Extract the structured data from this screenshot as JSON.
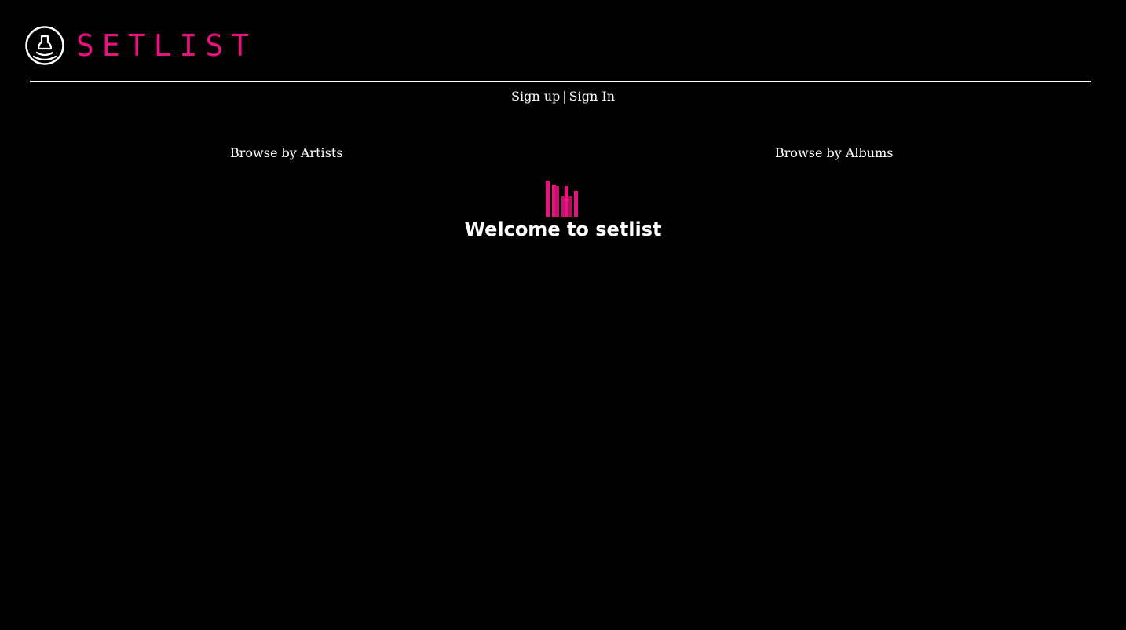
{
  "header": {
    "brand": "SETLIST",
    "logo_icon": "bell-waves-icon"
  },
  "auth": {
    "sign_up_label": "Sign up",
    "separator": "|",
    "sign_in_label": "Sign In"
  },
  "nav": {
    "browse_artists_label": "Browse by Artists",
    "browse_albums_label": "Browse by Albums"
  },
  "main": {
    "hero_icon": "equalizer-bars-icon",
    "welcome_title": "Welcome to setlist"
  },
  "colors": {
    "background": "#000000",
    "accent": "#e8137e",
    "text": "#ffffff"
  }
}
